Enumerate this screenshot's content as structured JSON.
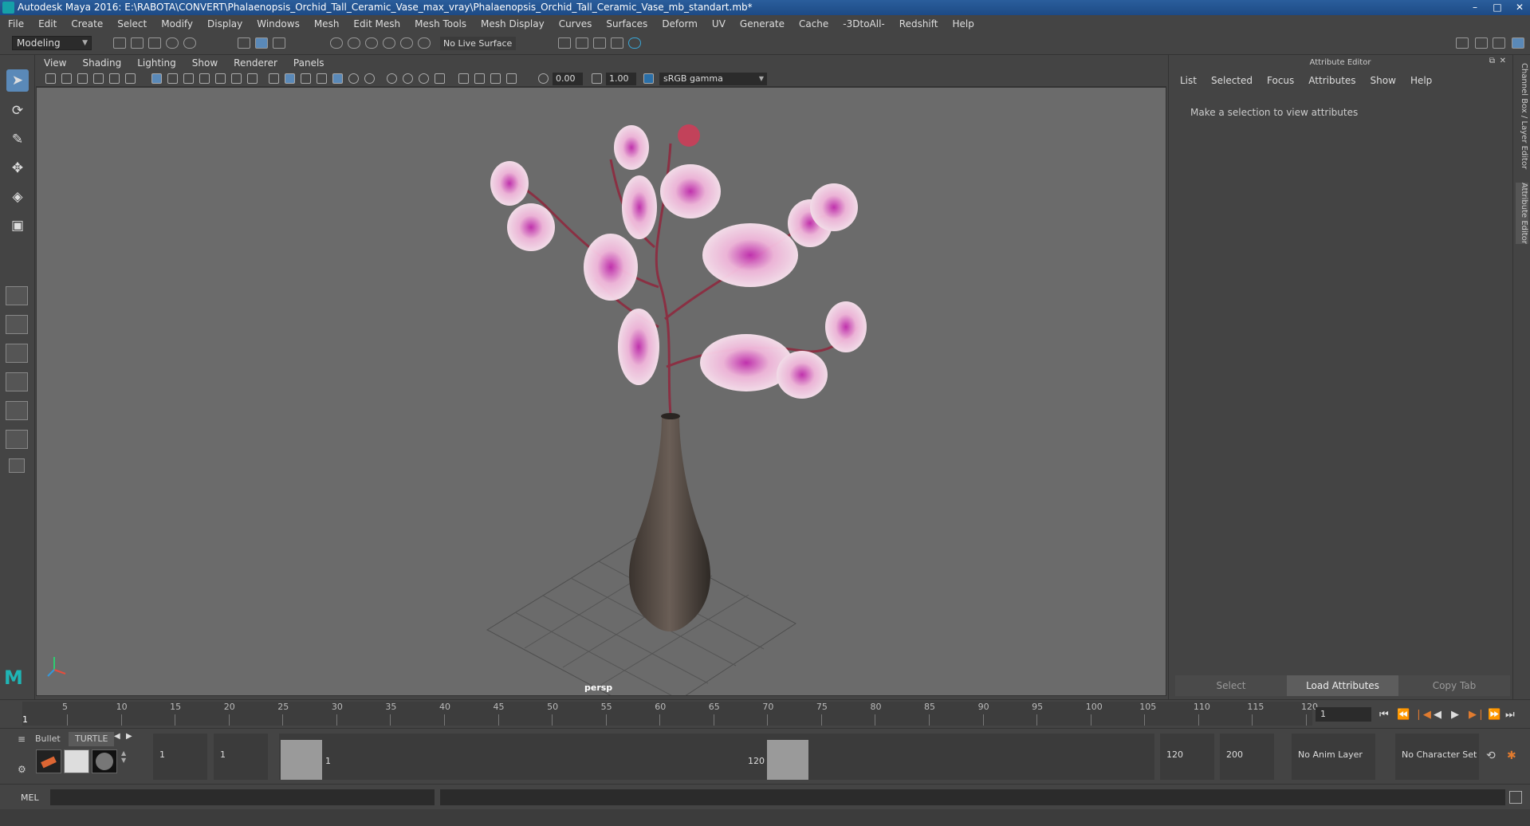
{
  "window": {
    "title": "Autodesk Maya 2016: E:\\RABOTA\\CONVERT\\Phalaenopsis_Orchid_Tall_Ceramic_Vase_max_vray\\Phalaenopsis_Orchid_Tall_Ceramic_Vase_mb_standart.mb*"
  },
  "menubar": [
    "File",
    "Edit",
    "Create",
    "Select",
    "Modify",
    "Display",
    "Windows",
    "Mesh",
    "Edit Mesh",
    "Mesh Tools",
    "Mesh Display",
    "Curves",
    "Surfaces",
    "Deform",
    "UV",
    "Generate",
    "Cache",
    "-3DtoAll-",
    "Redshift",
    "Help"
  ],
  "shelf": {
    "mode": "Modeling",
    "live_surface": "No Live Surface"
  },
  "viewport": {
    "menu": [
      "View",
      "Shading",
      "Lighting",
      "Show",
      "Renderer",
      "Panels"
    ],
    "exposure": "0.00",
    "gamma": "1.00",
    "color_space": "sRGB gamma",
    "camera_label": "persp"
  },
  "attribute_editor": {
    "header": "Attribute Editor",
    "menu": [
      "List",
      "Selected",
      "Focus",
      "Attributes",
      "Show",
      "Help"
    ],
    "message": "Make a selection to view attributes",
    "buttons": {
      "select": "Select",
      "load": "Load Attributes",
      "copy": "Copy Tab"
    }
  },
  "side_tabs": [
    "Channel Box / Layer Editor",
    "Attribute Editor"
  ],
  "timeline": {
    "ticks": [
      "5",
      "10",
      "15",
      "20",
      "25",
      "30",
      "35",
      "40",
      "45",
      "50",
      "55",
      "60",
      "65",
      "70",
      "75",
      "80",
      "85",
      "90",
      "95",
      "100",
      "105",
      "110",
      "115",
      "120"
    ],
    "start_label": "1",
    "current_frame": "1"
  },
  "range": {
    "shelf_tabs": [
      "Bullet",
      "TURTLE"
    ],
    "start_frame": "1",
    "playback_start": "1",
    "slider_start": "1",
    "slider_end": "120",
    "playback_end": "120",
    "end_frame": "200",
    "anim_layer": "No Anim Layer",
    "character_set": "No Character Set"
  },
  "command_line": {
    "label": "MEL"
  }
}
